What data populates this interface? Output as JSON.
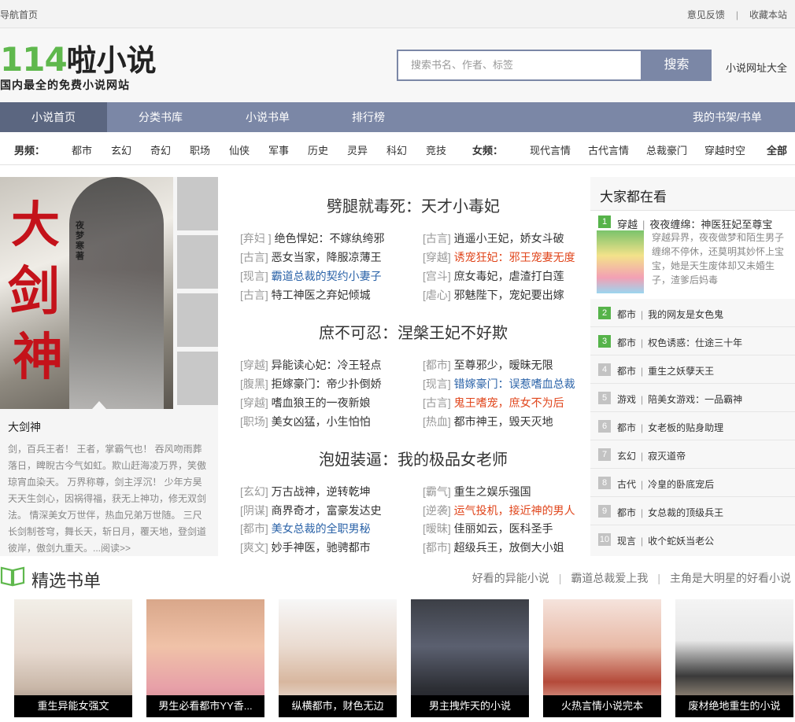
{
  "topbar": {
    "home": "导航首页",
    "feedback": "意见反馈",
    "sep": "|",
    "bookmark": "收藏本站"
  },
  "header": {
    "logo_num": "114",
    "logo_text": "啦小说",
    "slogan": "国内最全的免费小说网站",
    "search_placeholder": "搜索书名、作者、标签",
    "search_button": "搜索",
    "url_all": "小说网址大全"
  },
  "nav": [
    "小说首页",
    "分类书库",
    "小说书单",
    "排行榜",
    "我的书架/书单"
  ],
  "subnav": {
    "male_label": "男频：",
    "male": [
      "都市",
      "玄幻",
      "奇幻",
      "职场",
      "仙侠",
      "军事",
      "历史",
      "灵异",
      "科幻",
      "竞技"
    ],
    "female_label": "女频：",
    "female": [
      "现代言情",
      "古代言情",
      "总裁豪门",
      "穿越时空"
    ],
    "all": "全部"
  },
  "feature": {
    "cover_title": "大剑神",
    "cover_author": "夜梦寒著",
    "title": "大剑神",
    "desc": "剑，百兵王者！ 王者，掌霸气也！ 吞风吻雨葬落日，睥睨古今气如虹。欺山赶海凌万界，笑傲琼宵血染天。 万界称尊，剑主浮沉！ 少年方昊天天生剑心，因祸得福，获无上神功，修无双剑法。 情深美女万世伴，热血兄弟万世随。 三尺长剑制苍穹，舞长天，斩日月，覆天地，登剑道彼岸，傲剑九重天。...阅读>>"
  },
  "rec": {
    "groups": [
      {
        "head": "劈腿就毒死：天才小毒妃",
        "rows": [
          [
            {
              "tag": "[弃妇 ]",
              "title": "绝色悍妃：不嫁纨绔邪",
              "c": ""
            },
            {
              "tag": "[古言]",
              "title": "逍遥小王妃，娇女斗破",
              "c": ""
            }
          ],
          [
            {
              "tag": "[古言]",
              "title": "恶女当家，降服凉薄王",
              "c": ""
            },
            {
              "tag": "[穿越]",
              "title": "诱宠狂妃：邪王宠妻无度",
              "c": "orange"
            }
          ],
          [
            {
              "tag": "[现言]",
              "title": "霸道总裁的契约小妻子",
              "c": "blue"
            },
            {
              "tag": "[宫斗]",
              "title": "庶女毒妃，虐渣打白莲",
              "c": ""
            }
          ],
          [
            {
              "tag": "[古言]",
              "title": "特工神医之弃妃倾城",
              "c": ""
            },
            {
              "tag": "[虐心]",
              "title": "邪魅陛下，宠妃要出嫁",
              "c": ""
            }
          ]
        ]
      },
      {
        "head": "庶不可忍：涅槃王妃不好欺",
        "rows": [
          [
            {
              "tag": "[穿越]",
              "title": "异能读心妃：冷王轻点",
              "c": ""
            },
            {
              "tag": "[都市]",
              "title": "至尊邪少，暧昧无限",
              "c": ""
            }
          ],
          [
            {
              "tag": "[腹黑]",
              "title": "拒嫁豪门：帝少扑倒娇",
              "c": ""
            },
            {
              "tag": "[现言]",
              "title": "错嫁豪门：误惹嗜血总裁",
              "c": "blue"
            }
          ],
          [
            {
              "tag": "[穿越]",
              "title": "嗜血狼王的一夜新娘",
              "c": ""
            },
            {
              "tag": "[古言]",
              "title": "鬼王嗜宠，庶女不为后",
              "c": "orange"
            }
          ],
          [
            {
              "tag": "[职场]",
              "title": "美女凶猛，小生怕怕",
              "c": ""
            },
            {
              "tag": "[热血]",
              "title": "都市神王，毁天灭地",
              "c": ""
            }
          ]
        ]
      },
      {
        "head": "泡妞装逼：我的极品女老师",
        "rows": [
          [
            {
              "tag": "[玄幻]",
              "title": "万古战神，逆转乾坤",
              "c": ""
            },
            {
              "tag": "[霸气]",
              "title": "重生之娱乐强国",
              "c": ""
            }
          ],
          [
            {
              "tag": "[阴谋]",
              "title": "商界奇才，富豪发达史",
              "c": ""
            },
            {
              "tag": "[逆袭]",
              "title": "运气投机，接近神的男人",
              "c": "orange"
            }
          ],
          [
            {
              "tag": "[都市]",
              "title": "美女总裁的全职男秘",
              "c": "blue"
            },
            {
              "tag": "[暧昧]",
              "title": "佳丽如云，医科圣手",
              "c": ""
            }
          ],
          [
            {
              "tag": "[爽文]",
              "title": "妙手神医，驰骋都市",
              "c": ""
            },
            {
              "tag": "[都市]",
              "title": "超级兵王，放倒大小姐",
              "c": ""
            }
          ]
        ]
      }
    ]
  },
  "hot": {
    "title": "大家都在看",
    "first": {
      "rank": "1",
      "cat": "穿越",
      "name": "夜夜缠绵：神医狂妃至尊宝",
      "desc": "穿越异界，夜夜做梦和陌生男子缠绵不停休，还莫明其妙怀上宝宝，她是天生废体却又未婚生子，渣爹后妈毒"
    },
    "items": [
      {
        "rank": "2",
        "cat": "都市",
        "name": "我的网友是女色鬼"
      },
      {
        "rank": "3",
        "cat": "都市",
        "name": "权色诱惑：仕途三十年"
      },
      {
        "rank": "4",
        "cat": "都市",
        "name": "重生之妖孽天王"
      },
      {
        "rank": "5",
        "cat": "游戏",
        "name": "陪美女游戏：一品霸神"
      },
      {
        "rank": "6",
        "cat": "都市",
        "name": "女老板的贴身助理"
      },
      {
        "rank": "7",
        "cat": "玄幻",
        "name": "寂灭道帝"
      },
      {
        "rank": "8",
        "cat": "古代",
        "name": "冷皇的卧底宠后"
      },
      {
        "rank": "9",
        "cat": "都市",
        "name": "女总裁的顶级兵王"
      },
      {
        "rank": "10",
        "cat": "现言",
        "name": "收个蛇妖当老公"
      }
    ]
  },
  "booklist": {
    "title": "精选书单",
    "links": [
      "好看的异能小说",
      "霸道总裁爱上我",
      "主角是大明星的好看小说"
    ],
    "items": [
      {
        "cap": "重生异能女强文"
      },
      {
        "cap": "男生必看都市YY香..."
      },
      {
        "cap": "纵横都市，财色无边"
      },
      {
        "cap": "男主拽炸天的小说"
      },
      {
        "cap": "火热言情小说完本"
      },
      {
        "cap": "废材绝地重生的小说"
      }
    ]
  },
  "colors": {
    "accent": "#7b87a6",
    "nav_active": "#5b6680",
    "logo_green": "#5fb84d",
    "link_blue": "#2b63a8",
    "link_orange": "#e0451b"
  }
}
